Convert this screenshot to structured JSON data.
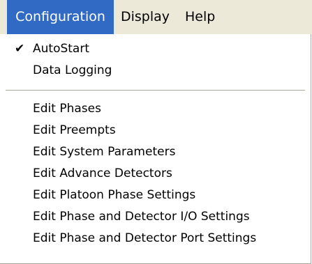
{
  "menubar": {
    "items": [
      "Configuration",
      "Display",
      "Help"
    ]
  },
  "dropdown": {
    "group1": [
      {
        "label": "AutoStart",
        "checked": true
      },
      {
        "label": "Data Logging",
        "checked": false
      }
    ],
    "group2": [
      {
        "label": "Edit Phases"
      },
      {
        "label": "Edit Preempts"
      },
      {
        "label": "Edit System Parameters"
      },
      {
        "label": "Edit Advance Detectors"
      },
      {
        "label": "Edit Platoon Phase Settings"
      },
      {
        "label": "Edit Phase and Detector I/O Settings"
      },
      {
        "label": "Edit Phase and Detector Port Settings"
      }
    ],
    "check_glyph": "✔"
  },
  "colors": {
    "highlight": "#316ac5",
    "menubar_bg": "#ece9d8",
    "separator": "#aca899"
  }
}
